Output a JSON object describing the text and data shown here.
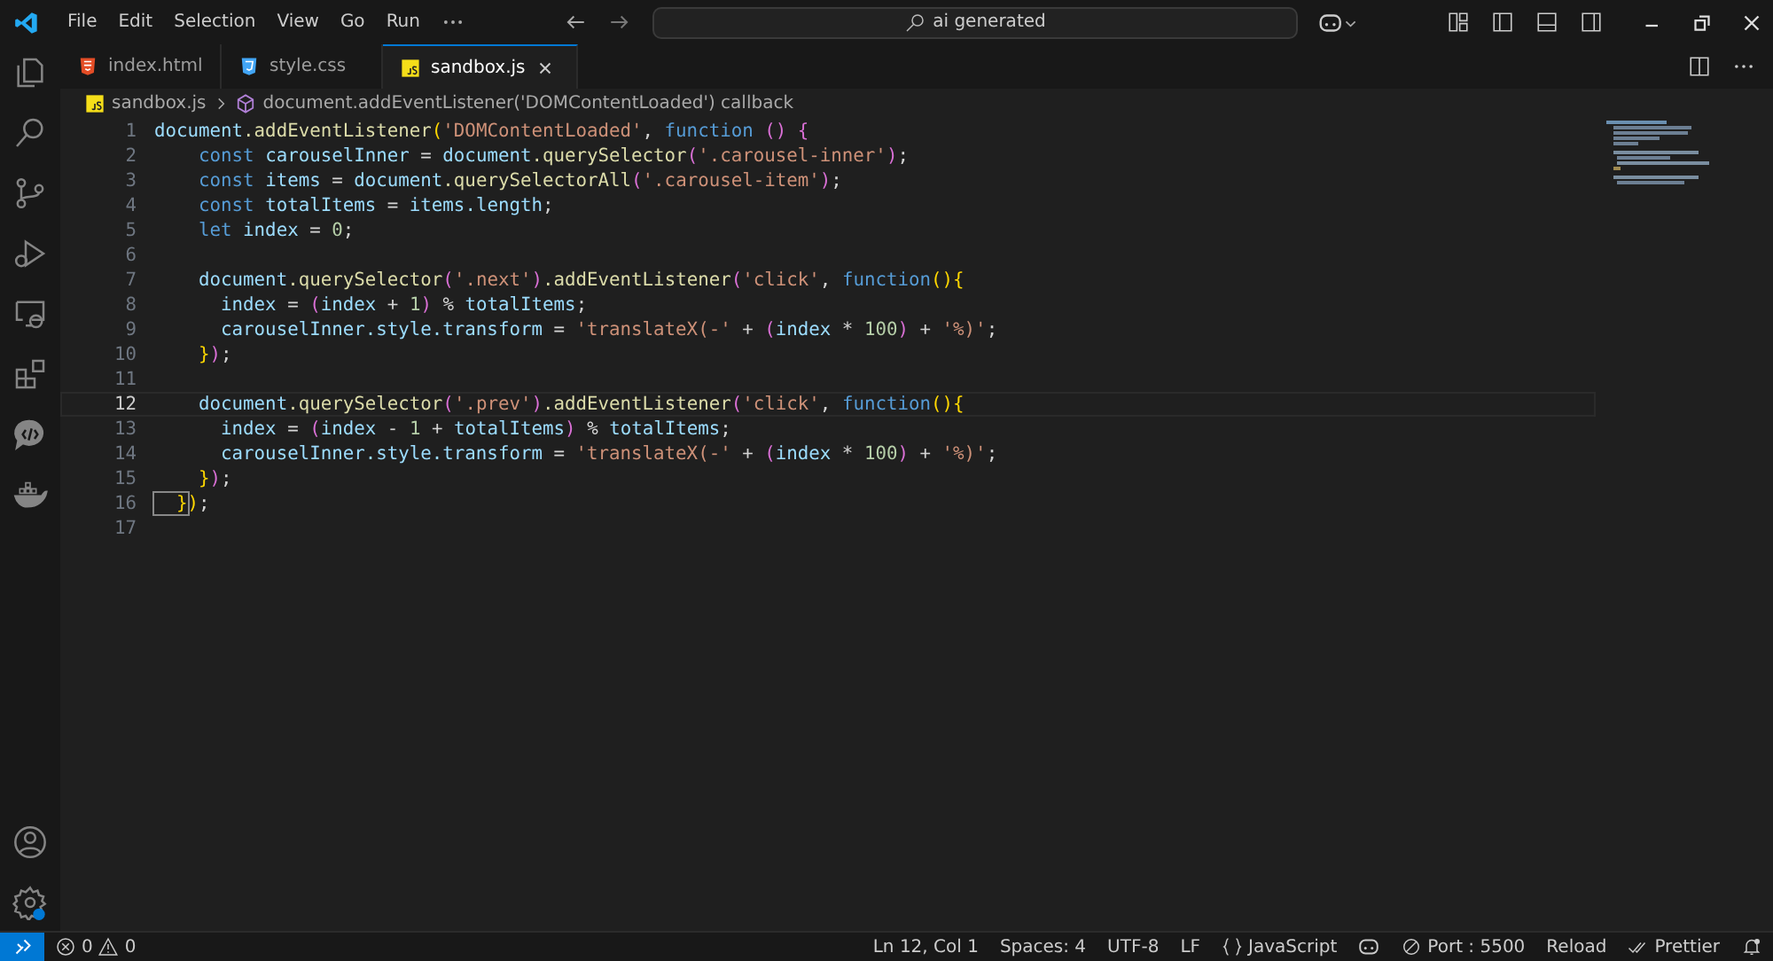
{
  "title_bar": {
    "menu": [
      "File",
      "Edit",
      "Selection",
      "View",
      "Go",
      "Run"
    ],
    "command_center": {
      "value": "ai generated"
    }
  },
  "activity_bar": {
    "top": [
      {
        "kind": "explorer"
      },
      {
        "kind": "search"
      },
      {
        "kind": "source-control"
      },
      {
        "kind": "run"
      },
      {
        "kind": "remote"
      },
      {
        "kind": "extensions"
      },
      {
        "kind": "chat"
      },
      {
        "kind": "docker"
      }
    ],
    "bottom": [
      {
        "kind": "account"
      },
      {
        "kind": "settings"
      }
    ]
  },
  "tabs": [
    {
      "label": "index.html",
      "kind": "html",
      "selected": false
    },
    {
      "label": "style.css",
      "kind": "css",
      "selected": false
    },
    {
      "label": "sandbox.js",
      "kind": "js",
      "selected": true
    }
  ],
  "breadcrumb": {
    "file": "sandbox.js",
    "symbol": "document.addEventListener('DOMContentLoaded') callback"
  },
  "editor": {
    "lines": [
      {
        "number": "1",
        "current": false,
        "tokens": [
          {
            "text": "document",
            "kind": "variable"
          },
          {
            "text": ".addEventListener",
            "kind": "function"
          },
          {
            "text": "(",
            "kind": "bracket1"
          },
          {
            "text": "'DOMContentLoaded'",
            "kind": "string"
          },
          {
            "text": ", ",
            "kind": "punctuation"
          },
          {
            "text": "function ",
            "kind": "keyword"
          },
          {
            "text": "() ",
            "kind": "bracket2"
          },
          {
            "text": "{",
            "kind": "bracket2"
          }
        ]
      },
      {
        "number": "2",
        "current": false,
        "tokens": [
          {
            "text": "    const ",
            "kind": "keyword"
          },
          {
            "text": "carouselInner",
            "kind": "variable"
          },
          {
            "text": " = ",
            "kind": "punctuation"
          },
          {
            "text": "document",
            "kind": "variable"
          },
          {
            "text": ".querySelector",
            "kind": "function"
          },
          {
            "text": "(",
            "kind": "bracket2"
          },
          {
            "text": "'.carousel-inner'",
            "kind": "string"
          },
          {
            "text": ")",
            "kind": "bracket2"
          },
          {
            "text": ";",
            "kind": "punctuation"
          }
        ]
      },
      {
        "number": "3",
        "current": false,
        "tokens": [
          {
            "text": "    const ",
            "kind": "keyword"
          },
          {
            "text": "items",
            "kind": "variable"
          },
          {
            "text": " = ",
            "kind": "punctuation"
          },
          {
            "text": "document",
            "kind": "variable"
          },
          {
            "text": ".querySelectorAll",
            "kind": "function"
          },
          {
            "text": "(",
            "kind": "bracket2"
          },
          {
            "text": "'.carousel-item'",
            "kind": "string"
          },
          {
            "text": ")",
            "kind": "bracket2"
          },
          {
            "text": ";",
            "kind": "punctuation"
          }
        ]
      },
      {
        "number": "4",
        "current": false,
        "tokens": [
          {
            "text": "    const ",
            "kind": "keyword"
          },
          {
            "text": "totalItems",
            "kind": "variable"
          },
          {
            "text": " = ",
            "kind": "punctuation"
          },
          {
            "text": "items",
            "kind": "variable"
          },
          {
            "text": ".length",
            "kind": "variable"
          },
          {
            "text": ";",
            "kind": "punctuation"
          }
        ]
      },
      {
        "number": "5",
        "current": false,
        "tokens": [
          {
            "text": "    let ",
            "kind": "keyword"
          },
          {
            "text": "index",
            "kind": "variable"
          },
          {
            "text": " = ",
            "kind": "punctuation"
          },
          {
            "text": "0",
            "kind": "number"
          },
          {
            "text": ";",
            "kind": "punctuation"
          }
        ]
      },
      {
        "number": "6",
        "current": false
      },
      {
        "number": "7",
        "current": false,
        "tokens": [
          {
            "text": "    document",
            "kind": "variable"
          },
          {
            "text": ".querySelector",
            "kind": "function"
          },
          {
            "text": "(",
            "kind": "bracket2"
          },
          {
            "text": "'.next'",
            "kind": "string"
          },
          {
            "text": ")",
            "kind": "bracket2"
          },
          {
            "text": ".addEventListener",
            "kind": "function"
          },
          {
            "text": "(",
            "kind": "bracket2"
          },
          {
            "text": "'click'",
            "kind": "string"
          },
          {
            "text": ", ",
            "kind": "punctuation"
          },
          {
            "text": "function",
            "kind": "keyword"
          },
          {
            "text": "(){",
            "kind": "bracket1"
          }
        ]
      },
      {
        "number": "8",
        "current": false,
        "tokens": [
          {
            "text": "      index",
            "kind": "variable"
          },
          {
            "text": " = ",
            "kind": "punctuation"
          },
          {
            "text": "(",
            "kind": "bracket2"
          },
          {
            "text": "index",
            "kind": "variable"
          },
          {
            "text": " + ",
            "kind": "punctuation"
          },
          {
            "text": "1",
            "kind": "number"
          },
          {
            "text": ")",
            "kind": "bracket2"
          },
          {
            "text": " % ",
            "kind": "punctuation"
          },
          {
            "text": "totalItems",
            "kind": "variable"
          },
          {
            "text": ";",
            "kind": "punctuation"
          }
        ]
      },
      {
        "number": "9",
        "current": false,
        "tokens": [
          {
            "text": "      carouselInner",
            "kind": "variable"
          },
          {
            "text": ".style",
            "kind": "variable"
          },
          {
            "text": ".transform",
            "kind": "variable"
          },
          {
            "text": " = ",
            "kind": "punctuation"
          },
          {
            "text": "'translateX(-'",
            "kind": "string"
          },
          {
            "text": " + ",
            "kind": "punctuation"
          },
          {
            "text": "(",
            "kind": "bracket2"
          },
          {
            "text": "index",
            "kind": "variable"
          },
          {
            "text": " * ",
            "kind": "punctuation"
          },
          {
            "text": "100",
            "kind": "number"
          },
          {
            "text": ")",
            "kind": "bracket2"
          },
          {
            "text": " + ",
            "kind": "punctuation"
          },
          {
            "text": "'%)'",
            "kind": "string"
          },
          {
            "text": ";",
            "kind": "punctuation"
          }
        ]
      },
      {
        "number": "10",
        "current": false,
        "tokens": [
          {
            "text": "    }",
            "kind": "bracket1"
          },
          {
            "text": ")",
            "kind": "bracket2"
          },
          {
            "text": ";",
            "kind": "punctuation"
          }
        ]
      },
      {
        "number": "11",
        "current": false
      },
      {
        "number": "12",
        "current": true,
        "tokens": [
          {
            "text": "    document",
            "kind": "variable"
          },
          {
            "text": ".querySelector",
            "kind": "function"
          },
          {
            "text": "(",
            "kind": "bracket2"
          },
          {
            "text": "'.prev'",
            "kind": "string"
          },
          {
            "text": ")",
            "kind": "bracket2"
          },
          {
            "text": ".addEventListener",
            "kind": "function"
          },
          {
            "text": "(",
            "kind": "bracket2"
          },
          {
            "text": "'click'",
            "kind": "string"
          },
          {
            "text": ", ",
            "kind": "punctuation"
          },
          {
            "text": "function",
            "kind": "keyword"
          },
          {
            "text": "(){",
            "kind": "bracket1"
          }
        ]
      },
      {
        "number": "13",
        "current": false,
        "tokens": [
          {
            "text": "      index",
            "kind": "variable"
          },
          {
            "text": " = ",
            "kind": "punctuation"
          },
          {
            "text": "(",
            "kind": "bracket2"
          },
          {
            "text": "index",
            "kind": "variable"
          },
          {
            "text": " - ",
            "kind": "punctuation"
          },
          {
            "text": "1",
            "kind": "number"
          },
          {
            "text": " + ",
            "kind": "punctuation"
          },
          {
            "text": "totalItems",
            "kind": "variable"
          },
          {
            "text": ")",
            "kind": "bracket2"
          },
          {
            "text": " % ",
            "kind": "punctuation"
          },
          {
            "text": "totalItems",
            "kind": "variable"
          },
          {
            "text": ";",
            "kind": "punctuation"
          }
        ]
      },
      {
        "number": "14",
        "current": false,
        "tokens": [
          {
            "text": "      carouselInner",
            "kind": "variable"
          },
          {
            "text": ".style",
            "kind": "variable"
          },
          {
            "text": ".transform",
            "kind": "variable"
          },
          {
            "text": " = ",
            "kind": "punctuation"
          },
          {
            "text": "'translateX(-'",
            "kind": "string"
          },
          {
            "text": " + ",
            "kind": "punctuation"
          },
          {
            "text": "(",
            "kind": "bracket2"
          },
          {
            "text": "index",
            "kind": "variable"
          },
          {
            "text": " * ",
            "kind": "punctuation"
          },
          {
            "text": "100",
            "kind": "number"
          },
          {
            "text": ")",
            "kind": "bracket2"
          },
          {
            "text": " + ",
            "kind": "punctuation"
          },
          {
            "text": "'%)'",
            "kind": "string"
          },
          {
            "text": ";",
            "kind": "punctuation"
          }
        ]
      },
      {
        "number": "15",
        "current": false,
        "tokens": [
          {
            "text": "    }",
            "kind": "bracket1"
          },
          {
            "text": ")",
            "kind": "bracket2"
          },
          {
            "text": ";",
            "kind": "punctuation"
          }
        ]
      },
      {
        "number": "16",
        "current": false,
        "tokens": [
          {
            "text": "  }",
            "kind": "matched-bracket"
          },
          {
            "text": ")",
            "kind": "bracket1"
          },
          {
            "text": ";",
            "kind": "punctuation"
          }
        ]
      },
      {
        "number": "17",
        "current": false
      }
    ]
  },
  "status_bar": {
    "errors": "0",
    "warnings": "0",
    "items": [
      {
        "kind": "text",
        "label": "Ln 12, Col 1"
      },
      {
        "kind": "text",
        "label": "Spaces: 4"
      },
      {
        "kind": "text",
        "label": "UTF-8"
      },
      {
        "kind": "text",
        "label": "LF"
      },
      {
        "kind": "language",
        "label": "JavaScript"
      },
      {
        "kind": "copilot"
      },
      {
        "kind": "port",
        "label": "Port : 5500"
      },
      {
        "kind": "text",
        "label": "Reload"
      },
      {
        "kind": "prettier",
        "label": "Prettier"
      },
      {
        "kind": "bell"
      }
    ]
  }
}
